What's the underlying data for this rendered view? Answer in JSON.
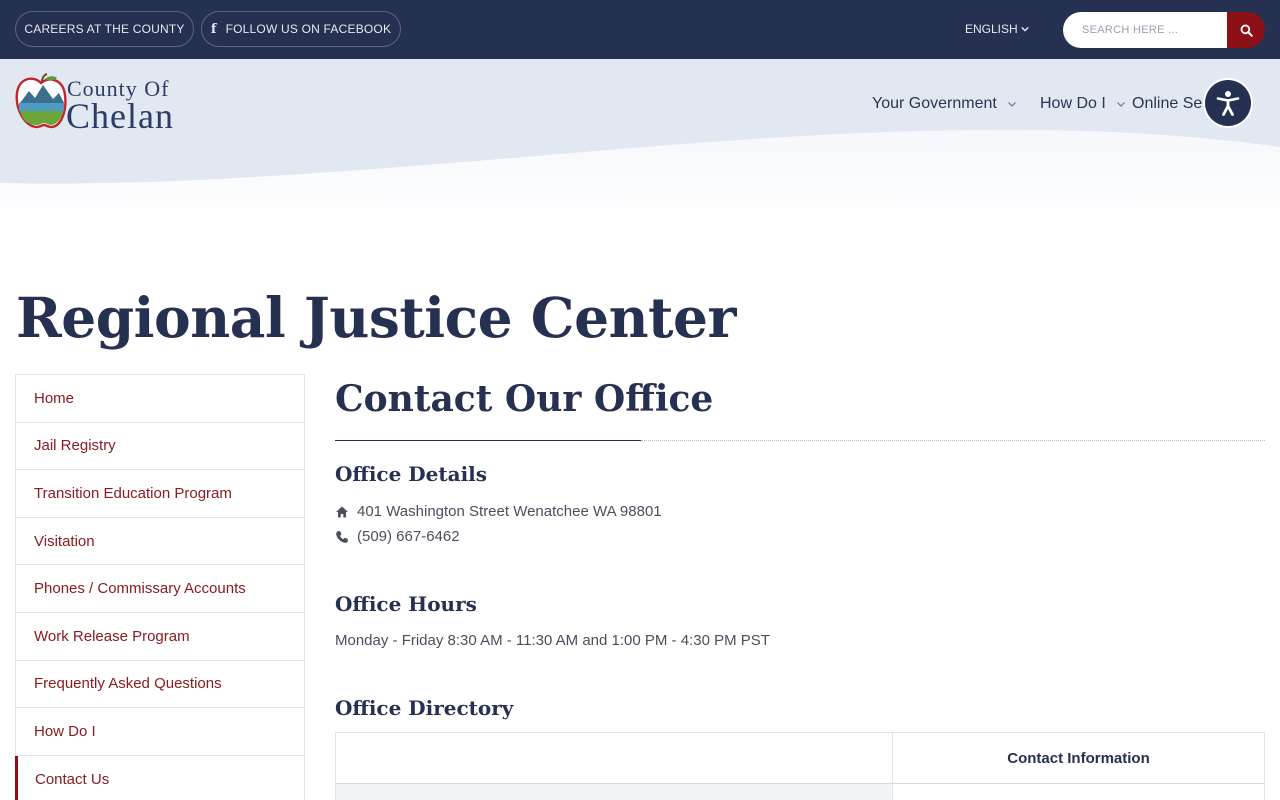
{
  "topbar": {
    "careers_label": "CAREERS AT THE COUNTY",
    "facebook_label": "FOLLOW US ON FACEBOOK",
    "language_label": "ENGLISH",
    "search_placeholder": "SEARCH HERE ..."
  },
  "logo": {
    "line1": "County Of",
    "line2": "Chelan"
  },
  "nav": {
    "items": [
      {
        "label": "Your Government"
      },
      {
        "label": "How Do I"
      },
      {
        "label": "Online Serv"
      }
    ]
  },
  "page": {
    "title": "Regional Justice Center"
  },
  "sidebar": {
    "items": [
      {
        "label": "Home"
      },
      {
        "label": "Jail Registry"
      },
      {
        "label": "Transition Education Program"
      },
      {
        "label": "Visitation"
      },
      {
        "label": "Phones / Commissary Accounts"
      },
      {
        "label": "Work Release Program"
      },
      {
        "label": "Frequently Asked Questions"
      },
      {
        "label": "How Do I"
      },
      {
        "label": "Contact Us"
      }
    ]
  },
  "main": {
    "heading": "Contact Our Office",
    "office_details": {
      "heading": "Office Details",
      "address": "401 Washington Street Wenatchee WA 98801",
      "phone": "(509) 667-6462"
    },
    "office_hours": {
      "heading": "Office Hours",
      "text": "Monday - Friday 8:30 AM - 11:30 AM and 1:00 PM - 4:30 PM PST"
    },
    "office_directory": {
      "heading": "Office Directory",
      "columns": [
        "",
        "Contact Information"
      ]
    }
  },
  "colors": {
    "navy": "#263050",
    "maroon": "#8c1016",
    "header_bg": "#e1e8f2"
  }
}
